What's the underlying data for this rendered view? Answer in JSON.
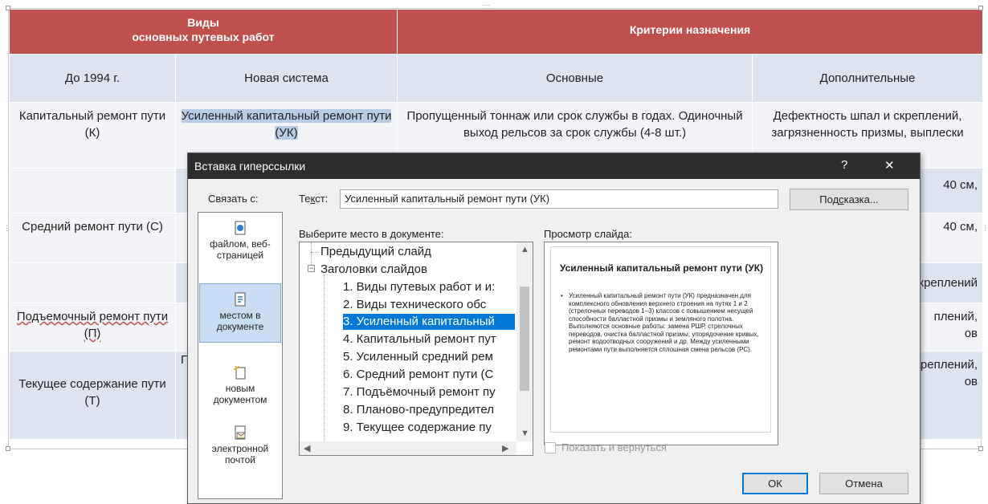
{
  "table": {
    "head1": {
      "col1": "Виды\nосновных путевых работ",
      "col2": "Критерии назначения"
    },
    "head2": [
      "До 1994 г.",
      "Новая система",
      "Основные",
      "Дополнительные"
    ],
    "rows": [
      {
        "old": "Капитальный ремонт пути (К)",
        "new": "Усиленный капитальный ремонт пути (УК)",
        "main": "Пропущенный тоннаж или срок службы в годах. Одиночный выход рельсов за срок службы (4-8 шт.)",
        "extra": "Дефектность шпал и скреплений, загрязненность призмы, выплески"
      },
      {
        "extra": "40 см,"
      },
      {
        "old": "Средний ремонт пути (С)",
        "extra": "40 см,"
      },
      {
        "extra": "скреплений"
      },
      {
        "old": "Подъемочный ремонт пути (П)",
        "extra": "плений,",
        "extra2": "ов"
      },
      {
        "old": "Текущее содержание пути (Т)",
        "frag": "П",
        "extra": "креплений,",
        "extra2": "ов"
      }
    ]
  },
  "dialog": {
    "title": "Вставка гиперссылки",
    "help": "?",
    "close": "✕",
    "link_with": "Связать с:",
    "text_label_pre": "Те",
    "text_label_u": "к",
    "text_label_post": "ст:",
    "text_value": "Усиленный капитальный ремонт пути (УК)",
    "hint_pre": "Под",
    "hint_u": "с",
    "hint_post": "казка...",
    "place_label": "Выберите место в документе:",
    "preview_label": "Просмотр слайда:",
    "link_items": [
      {
        "l1": "файлом, веб-",
        "l2": "страницей",
        "icon": "file-web-icon"
      },
      {
        "l1": "местом в",
        "l2": "документе",
        "icon": "place-in-document-icon"
      },
      {
        "l1": "новым",
        "l2": "документом",
        "icon": "new-document-icon"
      },
      {
        "l1": "электронной",
        "l2": "почтой",
        "icon": "email-icon"
      }
    ],
    "tree": [
      "Предыдущий слайд",
      "Заголовки слайдов",
      "1. Виды путевых работ и и:",
      "2.   Виды технического обс",
      "3. Усиленный капитальный",
      "4. Капитальный ремонт пут",
      "5. Усиленный средний рем",
      "6. Средний ремонт пути (С",
      "7. Подъёмочный ремонт пу",
      "8. Планово-предупредител",
      "9. Текущее содержание пу"
    ],
    "preview": {
      "title": "Усиленный капитальный ремонт пути (УК)",
      "body": "Усиленный капитальный ремонт пути (УК) предназначен для комплексного обновления верхнего строения на путях 1 и 2 (стрелочных переводов 1–3) классов с повышением несущей способности балластной призмы и земляного полотна. Выполняются основные работы: замена РШР, стрелочных переводов, очистка балластной призмы, упорядочение кривых, ремонт водоотводных сооружений и др. Между усиленными ремонтами пути выполняется сплошная смена рельсов (РС)."
    },
    "show_return": "Показать и вернуться",
    "ok": "ОК",
    "cancel": "Отмена"
  }
}
